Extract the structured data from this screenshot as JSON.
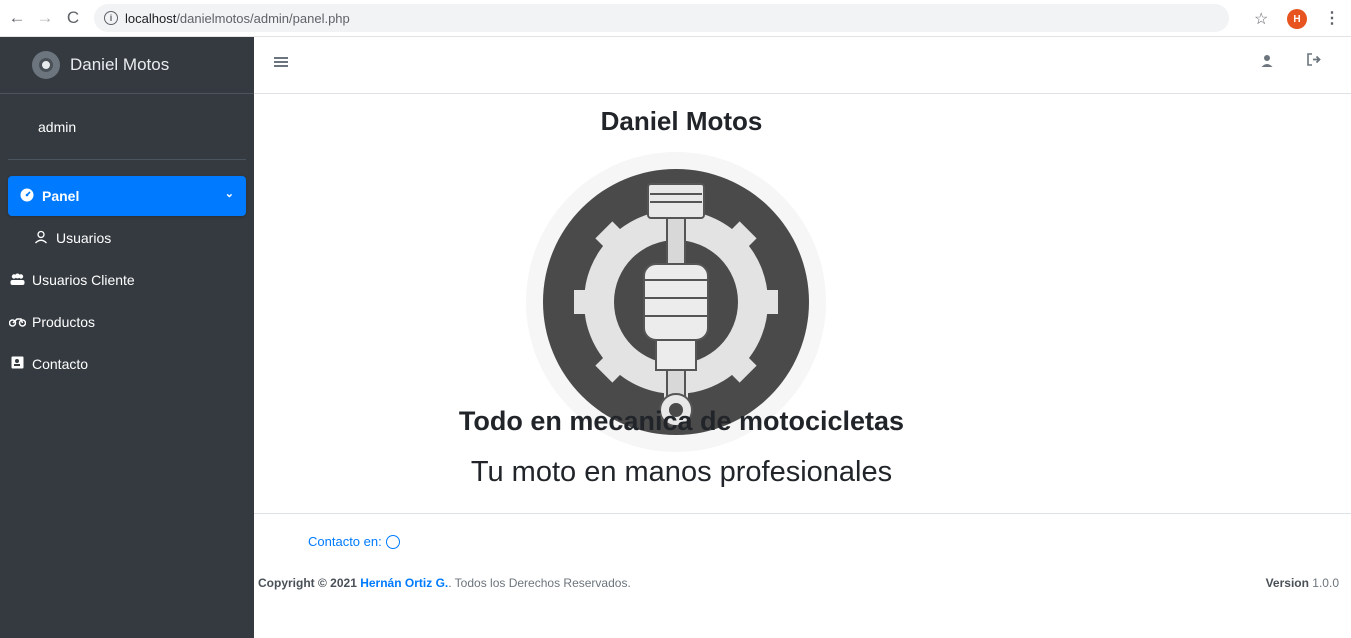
{
  "browser": {
    "back_icon": "←",
    "forward_icon": "→",
    "reload_icon": "C",
    "url_host": "localhost",
    "url_path": "/danielmotos/admin/panel.php",
    "profile_initial": "H"
  },
  "sidebar": {
    "brand": "Daniel Motos",
    "user": "admin",
    "items": [
      {
        "label": "Panel",
        "icon": "tachometer-icon"
      },
      {
        "label": "Usuarios",
        "icon": "user-icon"
      },
      {
        "label": "Usuarios Cliente",
        "icon": "users-icon"
      },
      {
        "label": "Productos",
        "icon": "motorcycle-icon"
      },
      {
        "label": "Contacto",
        "icon": "address-card-icon"
      }
    ]
  },
  "main": {
    "title": "Daniel Motos",
    "tagline": "Todo en mecanica de motocicletas",
    "subtitle": "Tu moto en manos profesionales"
  },
  "footer": {
    "contact_label": "Contacto en:",
    "copyright_prefix": "Copyright © 2021",
    "author": "Hernán Ortiz G.",
    "copyright_suffix": ". Todos los Derechos Reservados.",
    "version_label": "Version",
    "version_value": "1.0.0"
  },
  "colors": {
    "sidebar_bg": "#343a40",
    "active_item": "#007bff",
    "link": "#007bff"
  }
}
